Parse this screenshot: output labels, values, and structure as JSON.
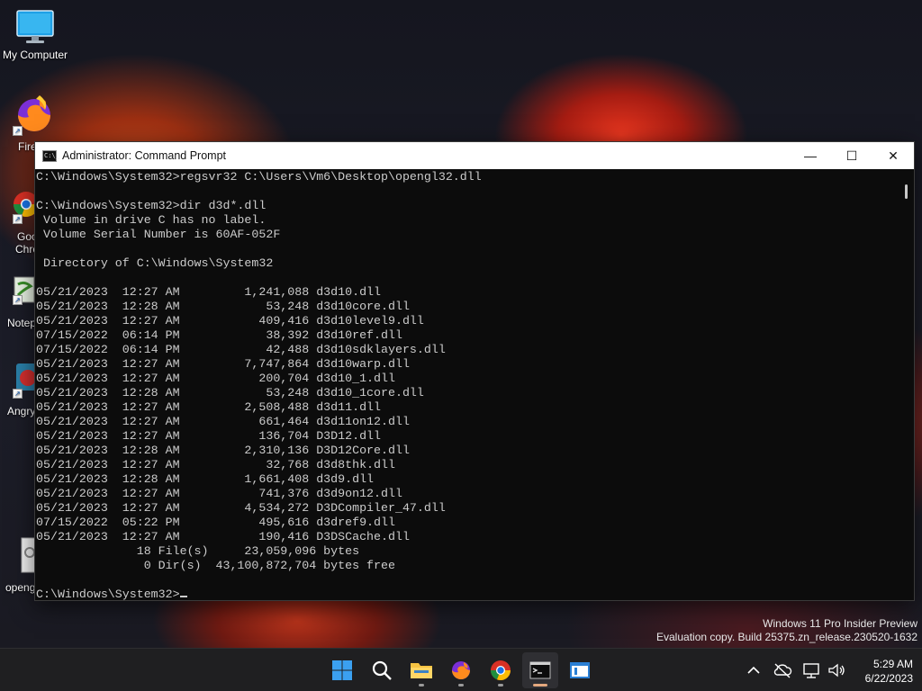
{
  "desktop": {
    "icons": [
      {
        "label": "My Computer",
        "icon": "monitor-icon"
      },
      {
        "label": "Fire",
        "icon": "firefox-icon"
      },
      {
        "label": "Goo",
        "label2": "Chro",
        "icon": "chrome-icon"
      },
      {
        "label": "Notep",
        "icon": "notepad-icon"
      },
      {
        "label": "Angry",
        "icon": "angry-birds-icon"
      },
      {
        "label": "openg",
        "icon": "dll-file-icon"
      }
    ]
  },
  "window": {
    "title": "Administrator: Command Prompt",
    "icon_text": "C:\\_",
    "minimize": "—",
    "maximize": "☐",
    "close": "✕"
  },
  "console": {
    "lines": [
      "C:\\Windows\\System32>regsvr32 C:\\Users\\Vm6\\Desktop\\opengl32.dll",
      "",
      "C:\\Windows\\System32>dir d3d*.dll",
      " Volume in drive C has no label.",
      " Volume Serial Number is 60AF-052F",
      "",
      " Directory of C:\\Windows\\System32",
      "",
      "05/21/2023  12:27 AM         1,241,088 d3d10.dll",
      "05/21/2023  12:28 AM            53,248 d3d10core.dll",
      "05/21/2023  12:27 AM           409,416 d3d10level9.dll",
      "07/15/2022  06:14 PM            38,392 d3d10ref.dll",
      "07/15/2022  06:14 PM            42,488 d3d10sdklayers.dll",
      "05/21/2023  12:27 AM         7,747,864 d3d10warp.dll",
      "05/21/2023  12:27 AM           200,704 d3d10_1.dll",
      "05/21/2023  12:28 AM            53,248 d3d10_1core.dll",
      "05/21/2023  12:27 AM         2,508,488 d3d11.dll",
      "05/21/2023  12:27 AM           661,464 d3d11on12.dll",
      "05/21/2023  12:27 AM           136,704 D3D12.dll",
      "05/21/2023  12:28 AM         2,310,136 D3D12Core.dll",
      "05/21/2023  12:27 AM            32,768 d3d8thk.dll",
      "05/21/2023  12:28 AM         1,661,408 d3d9.dll",
      "05/21/2023  12:27 AM           741,376 d3d9on12.dll",
      "05/21/2023  12:27 AM         4,534,272 D3DCompiler_47.dll",
      "07/15/2022  05:22 PM           495,616 d3dref9.dll",
      "05/21/2023  12:27 AM           190,416 D3DSCache.dll",
      "              18 File(s)     23,059,096 bytes",
      "               0 Dir(s)  43,100,872,704 bytes free",
      ""
    ],
    "prompt": "C:\\Windows\\System32>"
  },
  "watermark": {
    "line1": "Windows 11 Pro Insider Preview",
    "line2": "Evaluation copy. Build 25375.zn_release.230520-1632"
  },
  "taskbar": {
    "items": [
      {
        "name": "start-button",
        "icon": "windows-logo-icon"
      },
      {
        "name": "search-button",
        "icon": "search-icon"
      },
      {
        "name": "file-explorer-button",
        "icon": "folder-icon"
      },
      {
        "name": "firefox-button",
        "icon": "firefox-icon"
      },
      {
        "name": "chrome-button",
        "icon": "chrome-icon"
      },
      {
        "name": "command-prompt-button",
        "icon": "terminal-icon",
        "active": true
      },
      {
        "name": "notepad-taskbar-button",
        "icon": "window-icon"
      }
    ],
    "clock": {
      "time": "5:29 AM",
      "date": "6/22/2023"
    }
  },
  "colors": {
    "console_bg": "#0c0c0c",
    "console_fg": "#cccccc",
    "taskbar_bg": "#1f1f21",
    "active_indicator": "#e4a87e"
  }
}
